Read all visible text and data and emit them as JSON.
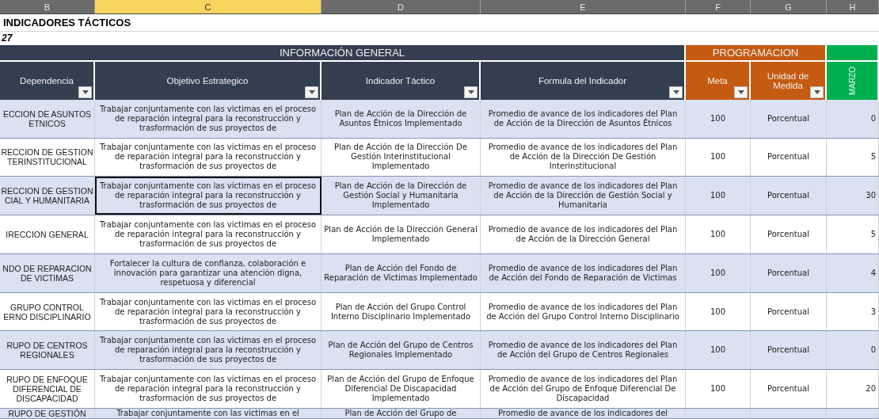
{
  "column_letters": [
    {
      "label": "B",
      "selected": false
    },
    {
      "label": "C",
      "selected": true
    },
    {
      "label": "D",
      "selected": false
    },
    {
      "label": "E",
      "selected": false
    },
    {
      "label": "F",
      "selected": false
    },
    {
      "label": "G",
      "selected": false
    },
    {
      "label": "H",
      "selected": false
    }
  ],
  "title": "INDICADORES TÁCTICOS",
  "subtitle": "27",
  "groups": [
    {
      "label": "INFORMACIÓN GENERAL",
      "color": "#333f50",
      "columns": [
        {
          "label": "Dependencia",
          "filter": true,
          "kind": "normal"
        },
        {
          "label": "Objetivo Estrategico",
          "filter": true,
          "kind": "normal"
        },
        {
          "label": "Indicador Táctico",
          "filter": true,
          "kind": "normal"
        },
        {
          "label": "Formula del Indicador",
          "filter": true,
          "kind": "normal"
        }
      ]
    },
    {
      "label": "PROGRAMACION",
      "color": "#c55a11",
      "columns": [
        {
          "label": "Meta",
          "filter": true,
          "kind": "normal"
        },
        {
          "label": "Unidad de Medida",
          "filter": true,
          "kind": "normal"
        }
      ]
    },
    {
      "color": "#00b050",
      "columns": [
        {
          "label": "MARZO",
          "filter": false,
          "kind": "vertical"
        }
      ]
    }
  ],
  "rows": [
    {
      "selected": false,
      "cells": [
        "ECCION DE ASUNTOS\nETNICOS",
        "Trabajar conjuntamente con las victimas en el proceso de reparación integral para la reconstrucción y trasformación de sus proyectos de",
        "Plan de Acción de la Dirección de Asuntos Étnicos Implementado",
        "Promedio de avance de los indicadores del Plan de Acción de la Dirección de Asuntos Étnicos",
        "100",
        "Porcentual",
        "0"
      ]
    },
    {
      "selected": false,
      "cells": [
        "RECCION DE GESTION\nTERINSTITUCIONAL",
        "Trabajar conjuntamente con las victimas en el proceso de reparación integral para la reconstrucción y trasformación de sus proyectos de",
        "Plan de Acción de la Dirección De Gestión Interinstitucional Implementado",
        "Promedio de avance de los indicadores del Plan de Acción de la Dirección De Gestión Interinstitucional",
        "100",
        "Porcentual",
        "5"
      ]
    },
    {
      "selected": true,
      "cells": [
        "RECCION DE GESTION\nCIAL Y HUMANITARIA",
        "Trabajar conjuntamente con las victimas en el proceso de reparación integral para la reconstrucción y trasformación de sus proyectos de",
        "Plan de Acción de la Dirección de Gestión Social y Humanitaria Implementado",
        "Promedio de avance de los indicadores del Plan de Acción de la Dirección de Gestión Social y Humanitaria",
        "100",
        "Porcentual",
        "30"
      ]
    },
    {
      "selected": false,
      "cells": [
        "IRECCION GENERAL",
        "Trabajar conjuntamente con las victimas en el proceso de reparación integral para la reconstrucción y trasformación de sus proyectos de",
        "Plan de Acción de la Dirección General Implementado",
        "Promedio de avance de los indicadores del Plan de Acción de la Dirección General",
        "100",
        "Porcentual",
        "5"
      ]
    },
    {
      "selected": false,
      "cells": [
        "NDO DE REPARACION\nDE VICTIMAS",
        "Fortalecer la cultura de confianza, colaboración e innovación para garantizar una atención  digna, respetuosa y diferencial",
        "Plan de Acción del Fondo de Reparación de Victimas Implementado",
        "Promedio de avance de los indicadores del Plan de Acción del Fondo de Reparación de Victimas",
        "100",
        "Porcentual",
        "4"
      ]
    },
    {
      "selected": false,
      "cells": [
        "GRUPO CONTROL\nERNO DISCIPLINARIO",
        "Trabajar conjuntamente con las victimas en el proceso de reparación integral para la reconstrucción y trasformación de sus proyectos de",
        "Plan de Acción del Grupo Control Interno Disciplinario Implementado",
        "Promedio de avance de los indicadores del Plan de Acción del Grupo Control Interno Disciplinario",
        "100",
        "Porcentual",
        "3"
      ]
    },
    {
      "selected": false,
      "cells": [
        "RUPO DE CENTROS\nREGIONALES",
        "Trabajar conjuntamente con las victimas en el proceso de reparación integral para la reconstrucción y trasformación de sus proyectos de",
        "Plan de Acción del Grupo de Centros Regionales Implementado",
        "Promedio de avance de los indicadores del Plan de Acción del Grupo de Centros Regionales",
        "100",
        "Porcentual",
        "0"
      ]
    },
    {
      "selected": false,
      "cells": [
        "RUPO DE ENFOQUE\nDIFERENCIAL DE\nDISCAPACIDAD",
        "Trabajar conjuntamente con las victimas en el proceso de reparación integral para la reconstrucción y trasformación de sus proyectos de",
        "Plan de Acción del Grupo de Enfoque Diferencial De Discapacidad Implementado",
        "Promedio de avance de los indicadores del Plan de Acción del Grupo de Enfoque Diferencial De Discapacidad",
        "100",
        "Porcentual",
        "20"
      ]
    },
    {
      "selected": false,
      "cells": [
        "RUPO DE GESTIÓN",
        "Trabajar conjuntamente con las victimas en el",
        "Plan de Acción del Grupo de",
        "Promedio de avance de los indicadores del"
      ]
    }
  ]
}
